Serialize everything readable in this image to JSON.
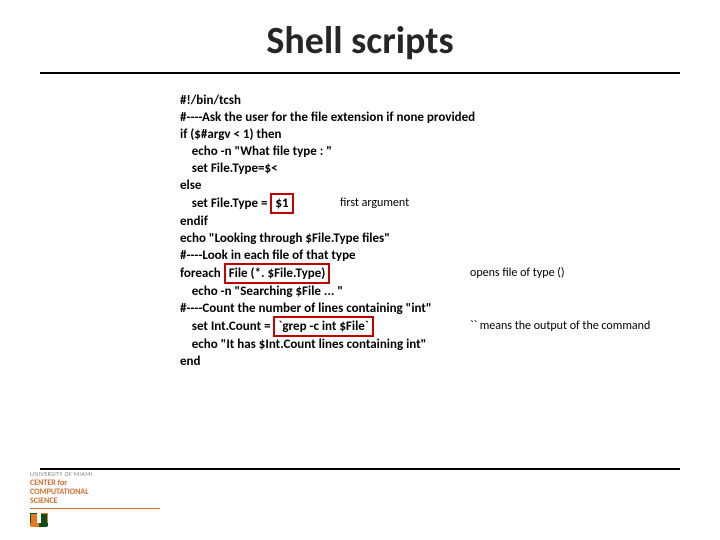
{
  "title": "Shell scripts",
  "code": {
    "l01": "#!/bin/tcsh",
    "l02": "",
    "l03": "#----Ask the user for the file extension if none provided",
    "l04": "if ($#argv < 1) then",
    "l05": "    echo -n \"What file type : \"",
    "l06": "    set File.Type=$<",
    "l07": "else",
    "l08a": "    set File.Type = ",
    "l08b": "$1",
    "l09": "endif",
    "l10": "",
    "l11": "echo \"Looking through $File.Type files\"",
    "l12": "",
    "l13": "#----Look in each file of that type",
    "l14a": "foreach ",
    "l14b": "File (*. $File.Type)",
    "l15": "    echo -n \"Searching $File ... \"",
    "l16": "#----Count the number of lines containing \"int\"",
    "l17a": "    set Int.Count = ",
    "l17b": "`grep -c int $File`",
    "l18": "    echo \"It has $Int.Count lines containing int\"",
    "l19": "end"
  },
  "annot": {
    "first_arg": "first argument",
    "opens_file": "opens file of type ()",
    "backtick": "`` means the output of the command"
  },
  "footer": {
    "univ": "UNIVERSITY OF MIAMI",
    "ctr1": "CENTER for",
    "ctr2": "COMPUTATIONAL",
    "ctr3": "SCIENCE"
  }
}
